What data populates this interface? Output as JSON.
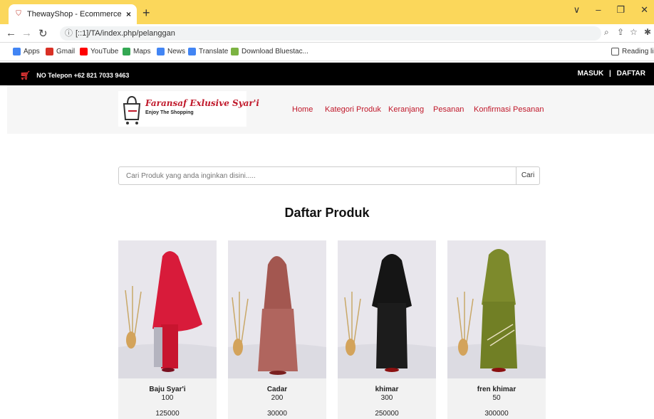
{
  "browser": {
    "tab_title": "ThewayShop - Ecommerce Boot",
    "tab_close": "×",
    "new_tab": "+",
    "url": "[::1]/TA/index.php/pelanggan",
    "window_controls": [
      "∨",
      "–",
      "❐",
      "✕"
    ],
    "bookmarks": [
      {
        "label": "Apps",
        "color": "#4285f4"
      },
      {
        "label": "Gmail",
        "color": "#d93025"
      },
      {
        "label": "YouTube",
        "color": "#ff0000"
      },
      {
        "label": "Maps",
        "color": "#34a853"
      },
      {
        "label": "News",
        "color": "#4285f4"
      },
      {
        "label": "Translate",
        "color": "#4285f4"
      },
      {
        "label": "Download Bluestac...",
        "color": "#7cb342"
      }
    ],
    "reading_list": "Reading lis"
  },
  "topbar": {
    "phone": "NO Telepon +62 821 7033 9463",
    "login": "MASUK",
    "separator": "|",
    "register": "DAFTAR"
  },
  "logo": {
    "title": "Faransaf Exlusive Syar'i",
    "subtitle": "Enjoy The Shopping"
  },
  "menu": [
    "Home",
    "Kategori Produk",
    "Keranjang",
    "Pesanan",
    "Konfirmasi Pesanan"
  ],
  "search": {
    "placeholder": "Cari Produk yang anda inginkan disini.....",
    "button": "Cari"
  },
  "heading": "Daftar Produk",
  "products": [
    {
      "name": "Baju Syar'i",
      "stock": "100",
      "price": "125000",
      "color": "#d81b3a"
    },
    {
      "name": "Cadar",
      "stock": "200",
      "price": "30000",
      "color": "#b0655e"
    },
    {
      "name": "khimar",
      "stock": "300",
      "price": "250000",
      "color": "#151515"
    },
    {
      "name": "fren khimar",
      "stock": "50",
      "price": "300000",
      "color": "#7d8a2c"
    }
  ],
  "colors": {
    "accent": "#c0182a",
    "tabbar": "#fbd75b",
    "topbar": "#000000"
  }
}
